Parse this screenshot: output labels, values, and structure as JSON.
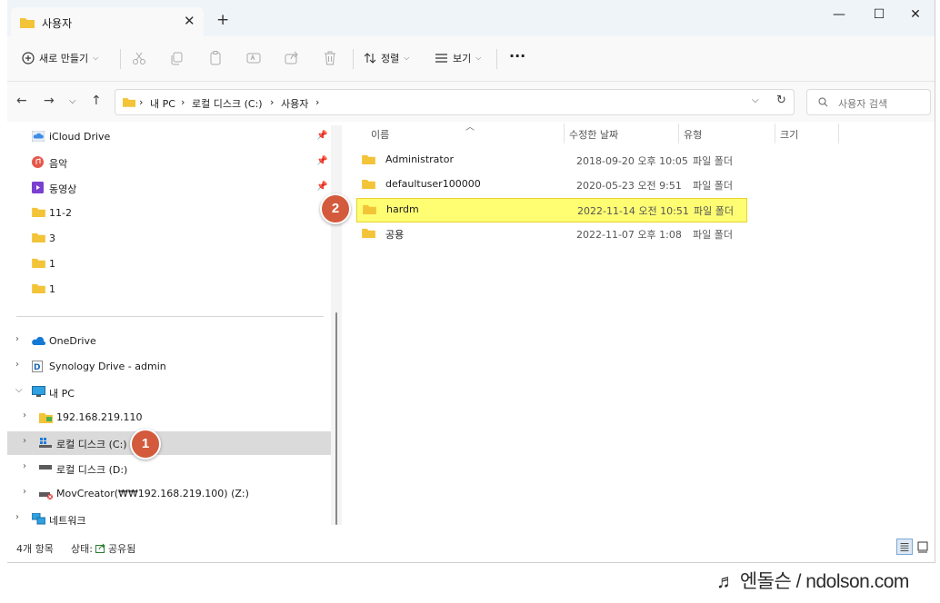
{
  "tab": {
    "title": "사용자",
    "close": "✕",
    "new": "+"
  },
  "window_buttons": {
    "minimize": "—",
    "maximize": "☐",
    "close": "✕"
  },
  "toolbar": {
    "new_label": "새로 만들기",
    "sort_label": "정렬",
    "view_label": "보기",
    "more_label": "···"
  },
  "address": {
    "crumbs": [
      "내 PC",
      "로컬 디스크 (C:)",
      "사용자"
    ],
    "search_placeholder": "사용자 검색"
  },
  "nav_pane": {
    "quick_access": [
      {
        "label": "iCloud Drive",
        "icon": "icloud-icon",
        "pinned": true
      },
      {
        "label": "음악",
        "icon": "music-icon",
        "pinned": true
      },
      {
        "label": "동영상",
        "icon": "video-icon",
        "pinned": true
      },
      {
        "label": "11-2",
        "icon": "folder-icon",
        "pinned": false
      },
      {
        "label": "3",
        "icon": "folder-icon",
        "pinned": false
      },
      {
        "label": "1",
        "icon": "folder-icon",
        "pinned": false
      },
      {
        "label": "1",
        "icon": "folder-icon",
        "pinned": false
      }
    ],
    "tree": [
      {
        "label": "OneDrive",
        "icon": "onedrive-icon",
        "expanded": false
      },
      {
        "label": "Synology Drive - admin",
        "icon": "synology-icon",
        "expanded": false
      },
      {
        "label": "내 PC",
        "icon": "pc-icon",
        "expanded": true
      },
      {
        "label": "192.168.219.110",
        "icon": "network-drive-icon",
        "expanded": false
      },
      {
        "label": "로컬 디스크 (C:)",
        "icon": "windows-drive-icon",
        "expanded": false,
        "selected": true
      },
      {
        "label": "로컬 디스크 (D:)",
        "icon": "drive-icon",
        "expanded": false
      },
      {
        "label": "MovCreator(₩₩192.168.219.100) (Z:)",
        "icon": "disconnected-drive-icon",
        "expanded": false
      },
      {
        "label": "네트워크",
        "icon": "network-icon",
        "expanded": false
      }
    ]
  },
  "file_list": {
    "columns": [
      "이름",
      "수정한 날짜",
      "유형",
      "크기"
    ],
    "rows": [
      {
        "name": "Administrator",
        "date": "2018-09-20 오후 10:05",
        "type": "파일 폴더"
      },
      {
        "name": "defaultuser100000",
        "date": "2020-05-23 오전 9:51",
        "type": "파일 폴더"
      },
      {
        "name": "hardm",
        "date": "2022-11-14 오전 10:51",
        "type": "파일 폴더",
        "highlighted": true
      },
      {
        "name": "공용",
        "date": "2022-11-07 오후 1:08",
        "type": "파일 폴더"
      }
    ]
  },
  "status": {
    "count": "4개 항목",
    "state_label": "상태:",
    "state_value": "공유됨"
  },
  "badges": {
    "step1": "1",
    "step2": "2"
  },
  "watermark": "♬ 엔돌슨 / ndolson.com",
  "colors": {
    "folder": "#f3c338",
    "badge": "#d35a3c",
    "highlight": "#fffe73",
    "selected": "#dadada"
  }
}
